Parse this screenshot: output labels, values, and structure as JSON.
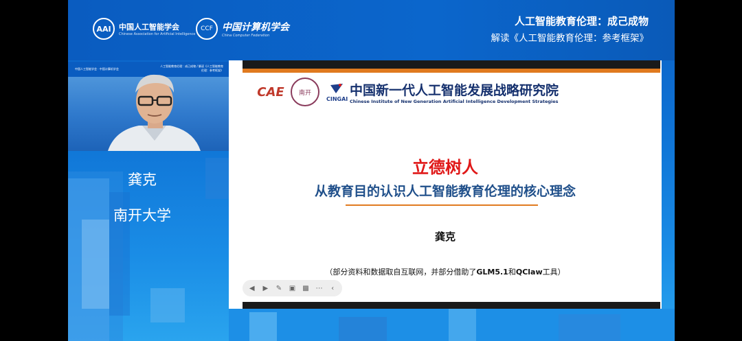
{
  "header": {
    "org1_cn": "中国人工智能学会",
    "org1_en": "Chinese Association for Artificial Intelligence",
    "org1_mark": "AAI",
    "org2_cn": "中国计算机学会",
    "org2_en": "China Computer Federation",
    "title": "人工智能教育伦理：成己成物",
    "subtitle": "解读《人工智能教育伦理：参考框架》"
  },
  "camera": {
    "mini_left": "中国人工智能学会 · 中国计算机学会",
    "mini_right": "人工智能教育伦理：成己成物 / 解读《人工智能教育伦理：参考框架》"
  },
  "speaker": {
    "name": "龚克",
    "affiliation": "南开大学"
  },
  "slide": {
    "seal1": "CAE",
    "seal2": "南开",
    "cing": "CINGAI",
    "institute_cn": "中国新一代人工智能发展战略研究院",
    "institute_en": "Chinese Institute of New Generation Artificial Intelligence Development Strategies",
    "main_title": "立德树人",
    "sub_title": "从教育目的认识人工智能教育伦理的核心理念",
    "author": "龚克",
    "note_prefix": "（部分资料和数据取自互联网，并部分借助了",
    "note_glm": "GLM5.1",
    "note_and": "和",
    "note_qclaw": "QClaw",
    "note_suffix": "工具）"
  },
  "toolbar": {
    "icons": [
      "back-icon",
      "play-icon",
      "pen-icon",
      "screenshot-icon",
      "video-icon",
      "more-icon",
      "collapse-icon"
    ]
  },
  "colors": {
    "accent_orange": "#e07a1f",
    "title_red": "#e01818",
    "subtitle_blue": "#1f4f8a",
    "bg_blue": "#0b5fc4"
  }
}
